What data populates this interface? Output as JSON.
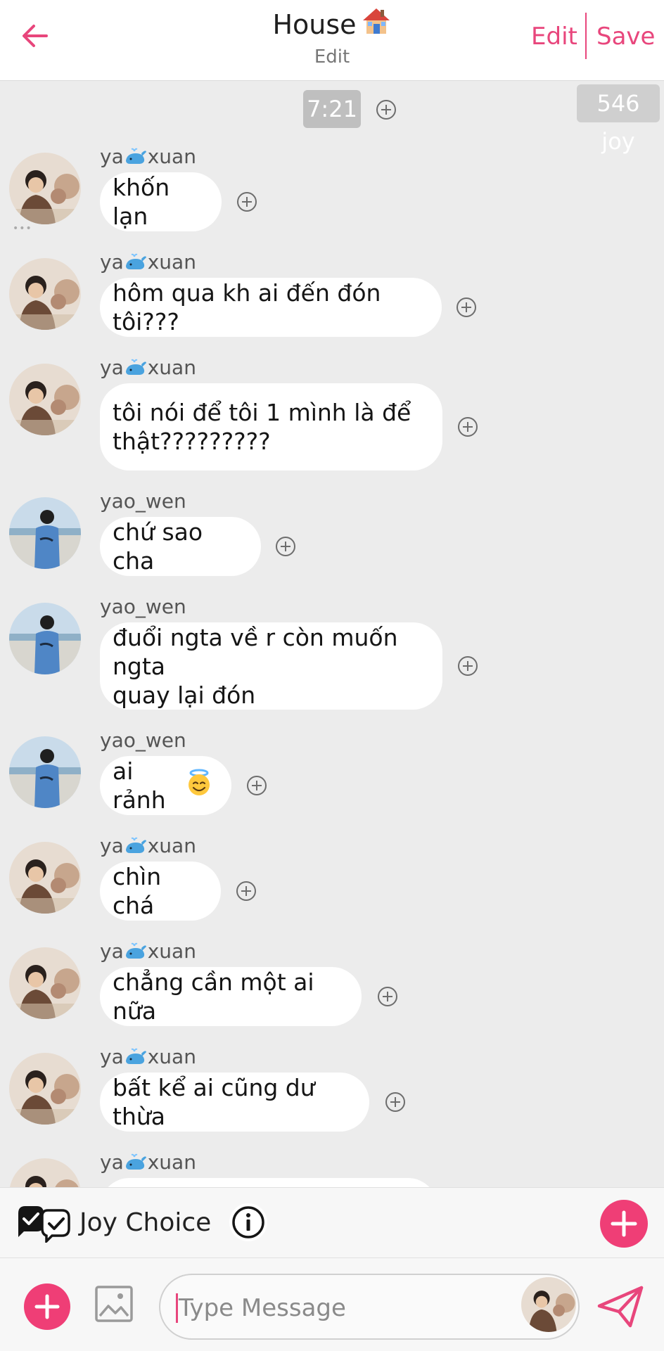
{
  "header": {
    "title": "House",
    "title_emoji": "house-icon",
    "subtitle": "Edit",
    "edit_label": "Edit",
    "save_label": "Save",
    "accent_color": "#e8467c"
  },
  "chat": {
    "time_label": "7:21",
    "joy_count": "546 joy",
    "messages": [
      {
        "user": "yao_xuan",
        "user_prefix": "ya",
        "user_suffix": "xuan",
        "text": "khốn lạn",
        "avatar": "avatar-yaoxuan"
      },
      {
        "user": "yao_xuan",
        "user_prefix": "ya",
        "user_suffix": "xuan",
        "text": "hôm qua kh ai đến đón tôi???",
        "avatar": "avatar-yaoxuan"
      },
      {
        "user": "yao_xuan",
        "user_prefix": "ya",
        "user_suffix": "xuan",
        "text": "tôi nói để tôi 1 mình là để\nthật?????????",
        "avatar": "avatar-yaoxuan"
      },
      {
        "user": "yao_wen",
        "text": "chứ sao cha",
        "avatar": "avatar-yaowen"
      },
      {
        "user": "yao_wen",
        "text": "đuổi ngta về r còn muốn ngta\nquay lại đón",
        "avatar": "avatar-yaowen"
      },
      {
        "user": "yao_wen",
        "text": "ai rảnh",
        "emoji": "smiling-face-with-halo",
        "avatar": "avatar-yaowen"
      },
      {
        "user": "yao_xuan",
        "user_prefix": "ya",
        "user_suffix": "xuan",
        "text": "chìn chá",
        "avatar": "avatar-yaoxuan"
      },
      {
        "user": "yao_xuan",
        "user_prefix": "ya",
        "user_suffix": "xuan",
        "text": "chẳng cần một ai nữa",
        "avatar": "avatar-yaoxuan"
      },
      {
        "user": "yao_xuan",
        "user_prefix": "ya",
        "user_suffix": "xuan",
        "text": "bất kể ai cũng dư thừa",
        "avatar": "avatar-yaoxuan"
      },
      {
        "user": "yao_xuan",
        "user_prefix": "ya",
        "user_suffix": "xuan",
        "text": "",
        "avatar": "avatar-yaoxuan"
      }
    ]
  },
  "joy_choice": {
    "label": "Joy Choice",
    "brand_color": "#ef3e76"
  },
  "composer": {
    "placeholder": "Type Message"
  }
}
